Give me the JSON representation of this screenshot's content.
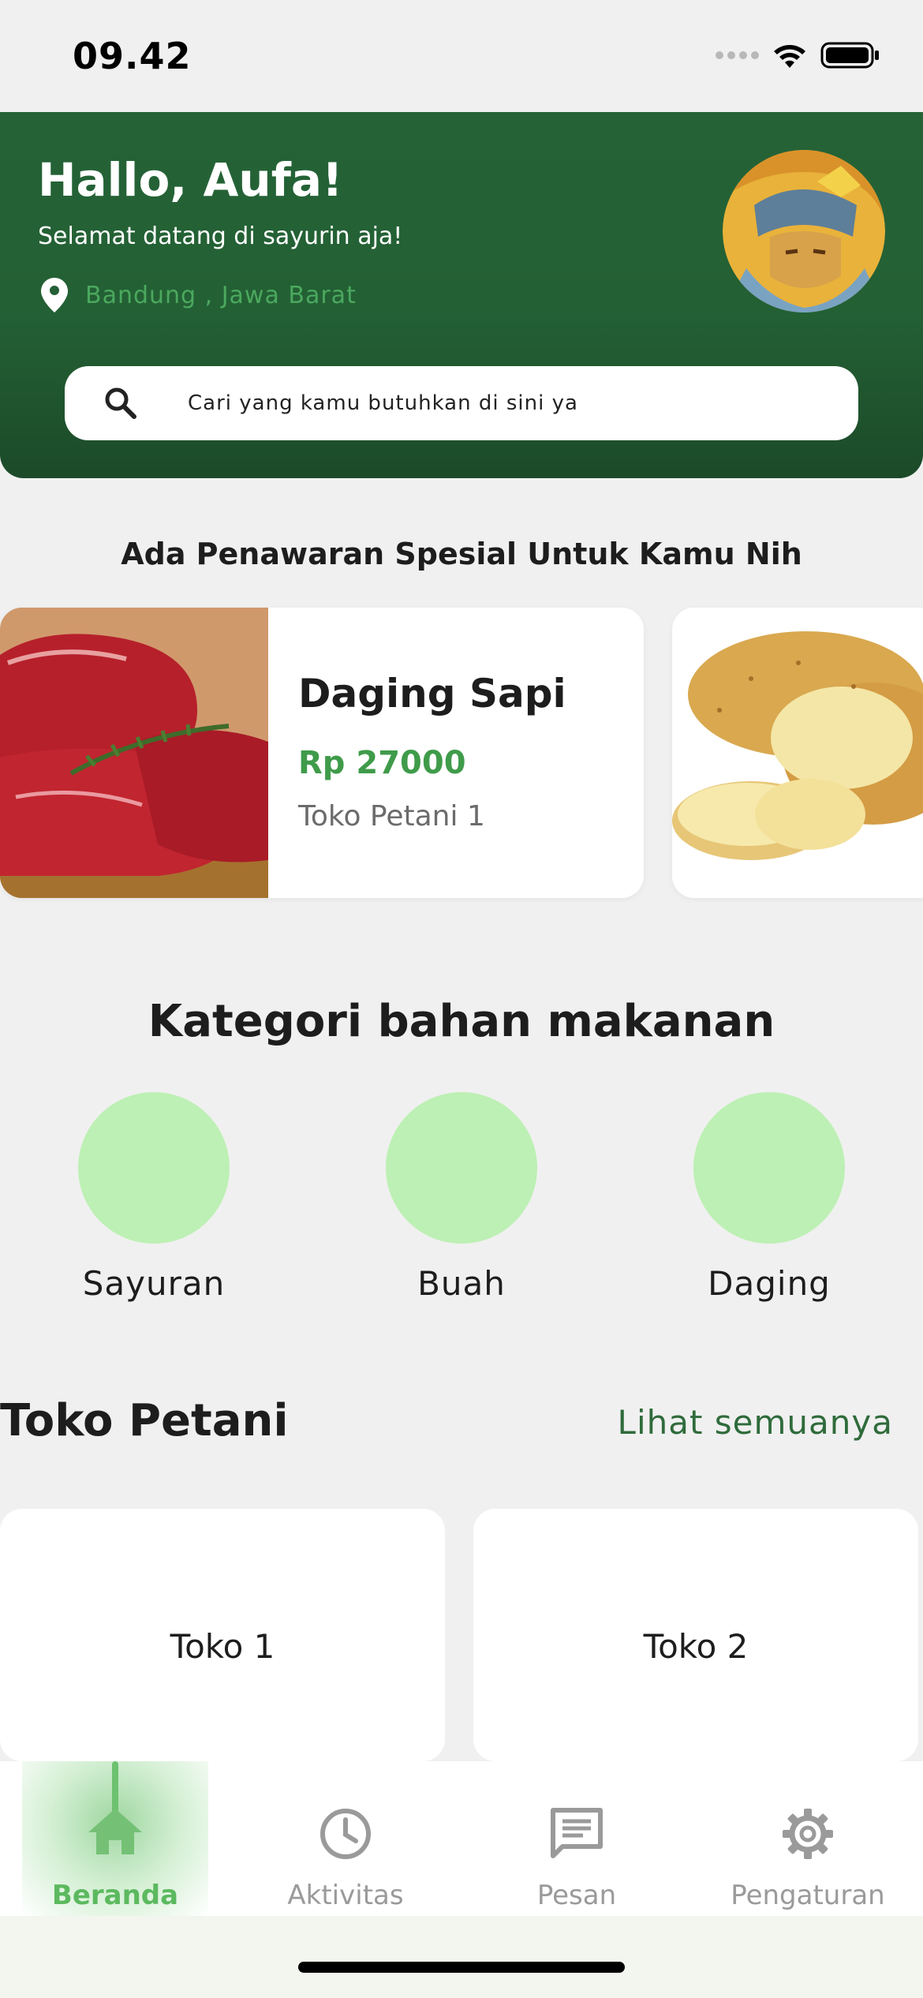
{
  "status_bar": {
    "time": "09.42"
  },
  "header": {
    "greeting": "Hallo, Aufa!",
    "welcome": "Selamat datang di sayurin aja!",
    "location": "Bandung , Jawa Barat",
    "search_placeholder": "Cari yang kamu butuhkan di sini ya"
  },
  "special": {
    "title": "Ada Penawaran Spesial Untuk Kamu Nih",
    "offers": [
      {
        "name": "Daging Sapi",
        "price": "Rp 27000",
        "store": "Toko Petani 1",
        "image": "beef"
      },
      {
        "image": "potato"
      }
    ]
  },
  "categories": {
    "title": "Kategori bahan makanan",
    "items": [
      {
        "label": "Sayuran"
      },
      {
        "label": "Buah"
      },
      {
        "label": "Daging"
      }
    ]
  },
  "stores": {
    "title": "Toko Petani",
    "see_all": "Lihat semuanya",
    "items": [
      {
        "name": "Toko 1"
      },
      {
        "name": "Toko 2"
      }
    ]
  },
  "nav": {
    "items": [
      {
        "label": "Beranda",
        "icon": "home-icon",
        "active": true
      },
      {
        "label": "Aktivitas",
        "icon": "clock-icon"
      },
      {
        "label": "Pesan",
        "icon": "message-icon"
      },
      {
        "label": "Pengaturan",
        "icon": "gear-icon"
      }
    ]
  },
  "colors": {
    "header_green": "#256337",
    "accent_green": "#3f9b4a",
    "category_circle": "#bdf0b4",
    "nav_active": "#5cb95f"
  }
}
